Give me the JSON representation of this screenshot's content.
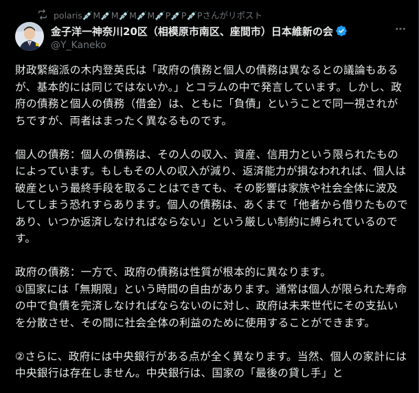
{
  "repost": {
    "text": "polaris💉M💉M💉M💉M💉P💉P💉Pさんがリポスト",
    "icon": "repost-icon"
  },
  "author": {
    "display_name": "金子洋一神奈川20区（相模原市南区、座間市）日本維新の会",
    "handle": "@Y_Kaneko",
    "verified_icon": "verified-badge-icon",
    "verified_color": "#1d9bf0",
    "avatar_icon": "avatar-photo"
  },
  "menu": {
    "more_icon": "more-options-icon"
  },
  "tweet": {
    "paragraphs": [
      "財政緊縮派の木内登英氏は「政府の債務と個人の債務は異なるとの議論もあるが、基本的には同じではないか。」とコラムの中で発言しています。しかし、政府の債務と個人の債務（借金）は、ともに「負債」ということで同一視されがちですが、両者はまったく異なるものです。",
      "個人の債務：個人の債務は、その人の収入、資産、信用力という限られたものによっています。もしもその人の収入が減り、返済能力が損なわれれば、個人は破産という最終手段を取ることはできても、その影響は家族や社会全体に波及してしまう恐れすらあります。個人の債務は、あくまで「他者から借りたものであり、いつか返済しなければならない」という厳しい制約に縛られているのです。",
      "政府の債務：一方で、政府の債務は性質が根本的に異なります。\n①国家には「無期限」という時間の自由があります。通常は個人が限られた寿命の中で負債を完済しなければならないのに対し、政府は未来世代にその支払いを分散させ、その間に社会全体の利益のために使用することができます。",
      "②さらに、政府には中央銀行がある点が全く異なります。当然、個人の家計には中央銀行は存在しません。中央銀行は、国家の「最後の貸し手」と"
    ]
  },
  "colors": {
    "background": "#000000",
    "text": "#e7e9ea",
    "secondary": "#71767b",
    "accent": "#1d9bf0"
  }
}
